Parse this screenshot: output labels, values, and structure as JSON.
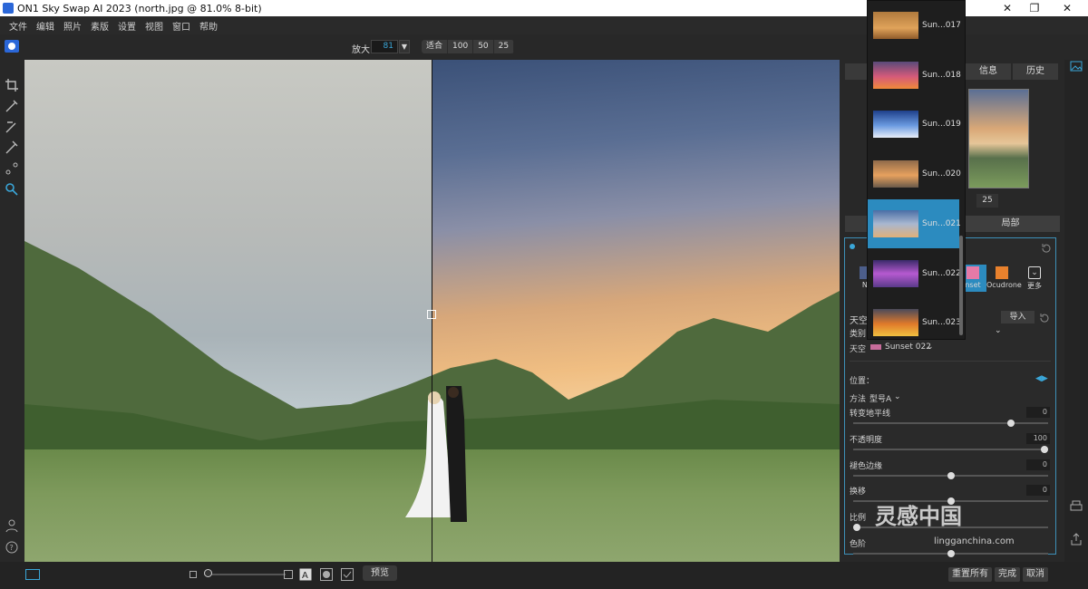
{
  "window": {
    "title": "ON1 Sky Swap AI 2023 (north.jpg @ 81.0% 8-bit)"
  },
  "menu": [
    "文件",
    "编辑",
    "照片",
    "素版",
    "设置",
    "视图",
    "窗口",
    "帮助"
  ],
  "toolbar": {
    "zoom_label": "放大",
    "zoom_value": "81",
    "zoom_buttons": [
      "适合",
      "100",
      "50",
      "25"
    ]
  },
  "panel_tabs": {
    "info": "信息",
    "history": "历史",
    "local": "局部",
    "zoom25": "25"
  },
  "sky_presets": {
    "dropdown_items": [
      "Sun...017",
      "Sun...018",
      "Sun...019",
      "Sun...020",
      "Sun...021",
      "Sun...022",
      "Sun...023"
    ],
    "selected_index": 4,
    "visible_presets": [
      "Ni",
      "nset",
      "Ocudrone",
      "更多"
    ]
  },
  "sky_section": {
    "title": "天空",
    "category_label": "类别",
    "sky_label": "天空",
    "sky_value": "Sunset 022",
    "import_label": "导入"
  },
  "position": {
    "title": "位置：",
    "method_label": "方法",
    "method_value": "型号A",
    "sliders": [
      {
        "label": "转变地平线",
        "value": "0",
        "fraction": 0.82
      },
      {
        "label": "不透明度",
        "value": "100",
        "fraction": 1.0
      },
      {
        "label": "褪色边缘",
        "value": "0",
        "fraction": 0.5
      },
      {
        "label": "换移",
        "value": "0",
        "fraction": 0.5
      },
      {
        "label": "比例",
        "value": "",
        "fraction": 0.0
      },
      {
        "label": "色阶",
        "value": "",
        "fraction": 0.5
      }
    ]
  },
  "bottom": {
    "preview": "预览",
    "reset_all": "重置所有",
    "done": "完成",
    "cancel": "取消"
  },
  "watermark": {
    "main": "灵感中国",
    "sub": "lingganchina.com"
  },
  "colors": {
    "accent": "#3aa6d8",
    "selected": "#2c8bbf"
  }
}
